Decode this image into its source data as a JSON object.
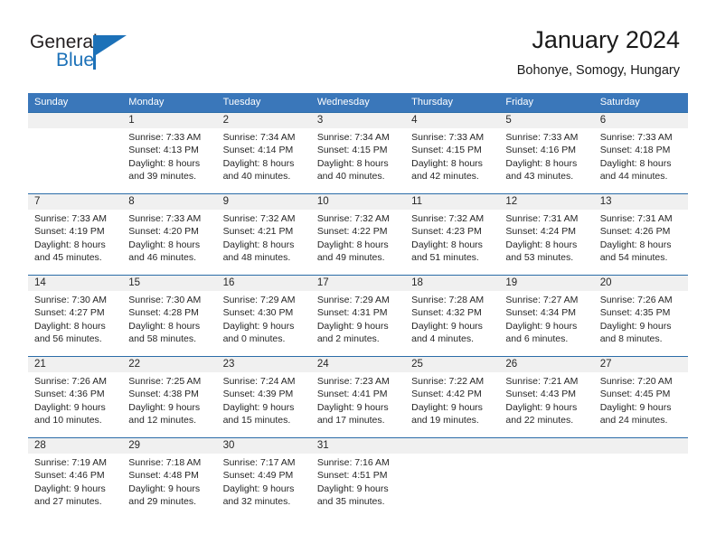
{
  "logo": {
    "word1": "General",
    "word2": "Blue",
    "accent_color": "#1c71b8"
  },
  "header": {
    "title": "January 2024",
    "subtitle": "Bohonye, Somogy, Hungary"
  },
  "theme": {
    "header_row_bg": "#3a77ba",
    "row_separator": "#2b6ca8",
    "day_number_bg": "#f0f0f0",
    "text_color": "#262626"
  },
  "weekdays": [
    "Sunday",
    "Monday",
    "Tuesday",
    "Wednesday",
    "Thursday",
    "Friday",
    "Saturday"
  ],
  "weeks": [
    [
      {
        "day": "",
        "lines": []
      },
      {
        "day": "1",
        "lines": [
          "Sunrise: 7:33 AM",
          "Sunset: 4:13 PM",
          "Daylight: 8 hours",
          "and 39 minutes."
        ]
      },
      {
        "day": "2",
        "lines": [
          "Sunrise: 7:34 AM",
          "Sunset: 4:14 PM",
          "Daylight: 8 hours",
          "and 40 minutes."
        ]
      },
      {
        "day": "3",
        "lines": [
          "Sunrise: 7:34 AM",
          "Sunset: 4:15 PM",
          "Daylight: 8 hours",
          "and 40 minutes."
        ]
      },
      {
        "day": "4",
        "lines": [
          "Sunrise: 7:33 AM",
          "Sunset: 4:15 PM",
          "Daylight: 8 hours",
          "and 42 minutes."
        ]
      },
      {
        "day": "5",
        "lines": [
          "Sunrise: 7:33 AM",
          "Sunset: 4:16 PM",
          "Daylight: 8 hours",
          "and 43 minutes."
        ]
      },
      {
        "day": "6",
        "lines": [
          "Sunrise: 7:33 AM",
          "Sunset: 4:18 PM",
          "Daylight: 8 hours",
          "and 44 minutes."
        ]
      }
    ],
    [
      {
        "day": "7",
        "lines": [
          "Sunrise: 7:33 AM",
          "Sunset: 4:19 PM",
          "Daylight: 8 hours",
          "and 45 minutes."
        ]
      },
      {
        "day": "8",
        "lines": [
          "Sunrise: 7:33 AM",
          "Sunset: 4:20 PM",
          "Daylight: 8 hours",
          "and 46 minutes."
        ]
      },
      {
        "day": "9",
        "lines": [
          "Sunrise: 7:32 AM",
          "Sunset: 4:21 PM",
          "Daylight: 8 hours",
          "and 48 minutes."
        ]
      },
      {
        "day": "10",
        "lines": [
          "Sunrise: 7:32 AM",
          "Sunset: 4:22 PM",
          "Daylight: 8 hours",
          "and 49 minutes."
        ]
      },
      {
        "day": "11",
        "lines": [
          "Sunrise: 7:32 AM",
          "Sunset: 4:23 PM",
          "Daylight: 8 hours",
          "and 51 minutes."
        ]
      },
      {
        "day": "12",
        "lines": [
          "Sunrise: 7:31 AM",
          "Sunset: 4:24 PM",
          "Daylight: 8 hours",
          "and 53 minutes."
        ]
      },
      {
        "day": "13",
        "lines": [
          "Sunrise: 7:31 AM",
          "Sunset: 4:26 PM",
          "Daylight: 8 hours",
          "and 54 minutes."
        ]
      }
    ],
    [
      {
        "day": "14",
        "lines": [
          "Sunrise: 7:30 AM",
          "Sunset: 4:27 PM",
          "Daylight: 8 hours",
          "and 56 minutes."
        ]
      },
      {
        "day": "15",
        "lines": [
          "Sunrise: 7:30 AM",
          "Sunset: 4:28 PM",
          "Daylight: 8 hours",
          "and 58 minutes."
        ]
      },
      {
        "day": "16",
        "lines": [
          "Sunrise: 7:29 AM",
          "Sunset: 4:30 PM",
          "Daylight: 9 hours",
          "and 0 minutes."
        ]
      },
      {
        "day": "17",
        "lines": [
          "Sunrise: 7:29 AM",
          "Sunset: 4:31 PM",
          "Daylight: 9 hours",
          "and 2 minutes."
        ]
      },
      {
        "day": "18",
        "lines": [
          "Sunrise: 7:28 AM",
          "Sunset: 4:32 PM",
          "Daylight: 9 hours",
          "and 4 minutes."
        ]
      },
      {
        "day": "19",
        "lines": [
          "Sunrise: 7:27 AM",
          "Sunset: 4:34 PM",
          "Daylight: 9 hours",
          "and 6 minutes."
        ]
      },
      {
        "day": "20",
        "lines": [
          "Sunrise: 7:26 AM",
          "Sunset: 4:35 PM",
          "Daylight: 9 hours",
          "and 8 minutes."
        ]
      }
    ],
    [
      {
        "day": "21",
        "lines": [
          "Sunrise: 7:26 AM",
          "Sunset: 4:36 PM",
          "Daylight: 9 hours",
          "and 10 minutes."
        ]
      },
      {
        "day": "22",
        "lines": [
          "Sunrise: 7:25 AM",
          "Sunset: 4:38 PM",
          "Daylight: 9 hours",
          "and 12 minutes."
        ]
      },
      {
        "day": "23",
        "lines": [
          "Sunrise: 7:24 AM",
          "Sunset: 4:39 PM",
          "Daylight: 9 hours",
          "and 15 minutes."
        ]
      },
      {
        "day": "24",
        "lines": [
          "Sunrise: 7:23 AM",
          "Sunset: 4:41 PM",
          "Daylight: 9 hours",
          "and 17 minutes."
        ]
      },
      {
        "day": "25",
        "lines": [
          "Sunrise: 7:22 AM",
          "Sunset: 4:42 PM",
          "Daylight: 9 hours",
          "and 19 minutes."
        ]
      },
      {
        "day": "26",
        "lines": [
          "Sunrise: 7:21 AM",
          "Sunset: 4:43 PM",
          "Daylight: 9 hours",
          "and 22 minutes."
        ]
      },
      {
        "day": "27",
        "lines": [
          "Sunrise: 7:20 AM",
          "Sunset: 4:45 PM",
          "Daylight: 9 hours",
          "and 24 minutes."
        ]
      }
    ],
    [
      {
        "day": "28",
        "lines": [
          "Sunrise: 7:19 AM",
          "Sunset: 4:46 PM",
          "Daylight: 9 hours",
          "and 27 minutes."
        ]
      },
      {
        "day": "29",
        "lines": [
          "Sunrise: 7:18 AM",
          "Sunset: 4:48 PM",
          "Daylight: 9 hours",
          "and 29 minutes."
        ]
      },
      {
        "day": "30",
        "lines": [
          "Sunrise: 7:17 AM",
          "Sunset: 4:49 PM",
          "Daylight: 9 hours",
          "and 32 minutes."
        ]
      },
      {
        "day": "31",
        "lines": [
          "Sunrise: 7:16 AM",
          "Sunset: 4:51 PM",
          "Daylight: 9 hours",
          "and 35 minutes."
        ]
      },
      {
        "day": "",
        "lines": []
      },
      {
        "day": "",
        "lines": []
      },
      {
        "day": "",
        "lines": []
      }
    ]
  ]
}
